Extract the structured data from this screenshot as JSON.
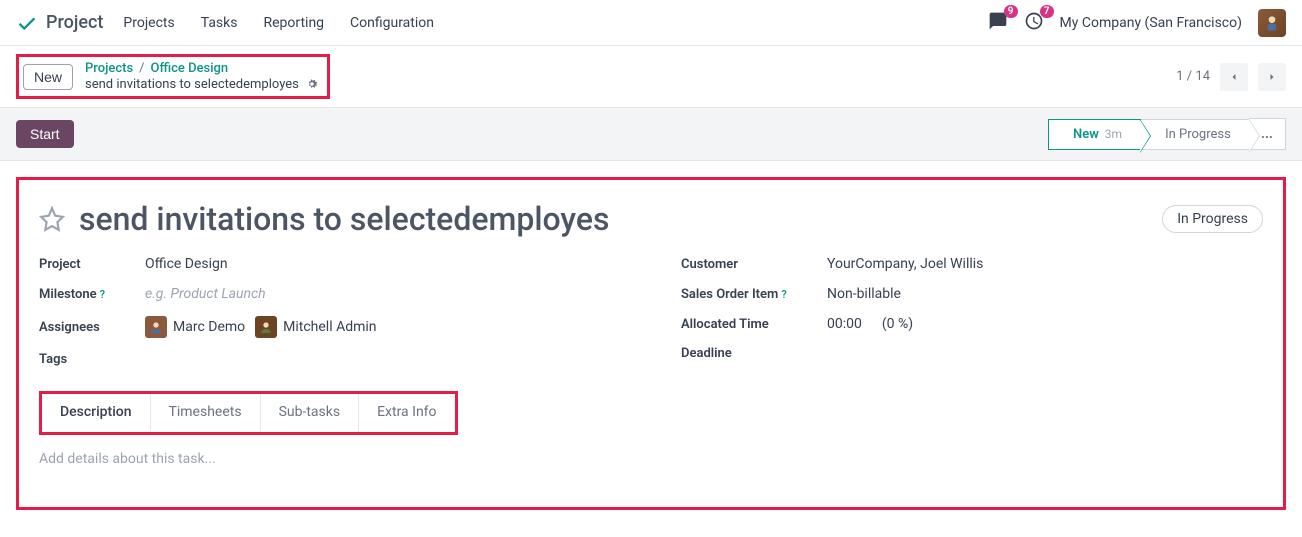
{
  "topbar": {
    "brand": "Project",
    "nav": [
      "Projects",
      "Tasks",
      "Reporting",
      "Configuration"
    ],
    "messages_badge": "9",
    "activities_badge": "7",
    "company": "My Company (San Francisco)"
  },
  "breadcrumb": {
    "new_label": "New",
    "root": "Projects",
    "project": "Office Design",
    "current": "send invitations to selectedemployes",
    "pager": "1 / 14"
  },
  "action_bar": {
    "start_label": "Start",
    "stages": {
      "new": "New",
      "new_time": "3m",
      "in_progress": "In Progress",
      "more": "..."
    }
  },
  "task": {
    "title": "send invitations to selectedemployes",
    "status": "In Progress",
    "fields": {
      "project_label": "Project",
      "project_value": "Office Design",
      "milestone_label": "Milestone",
      "milestone_placeholder": "e.g. Product Launch",
      "assignees_label": "Assignees",
      "assignees": [
        {
          "name": "Marc Demo"
        },
        {
          "name": "Mitchell Admin"
        }
      ],
      "tags_label": "Tags",
      "customer_label": "Customer",
      "customer_value": "YourCompany, Joel Willis",
      "sales_order_label": "Sales Order Item",
      "sales_order_value": "Non-billable",
      "allocated_label": "Allocated Time",
      "allocated_time": "00:00",
      "allocated_pct": "(0 %)",
      "deadline_label": "Deadline"
    },
    "tabs": [
      "Description",
      "Timesheets",
      "Sub-tasks",
      "Extra Info"
    ],
    "details_placeholder": "Add details about this task..."
  }
}
